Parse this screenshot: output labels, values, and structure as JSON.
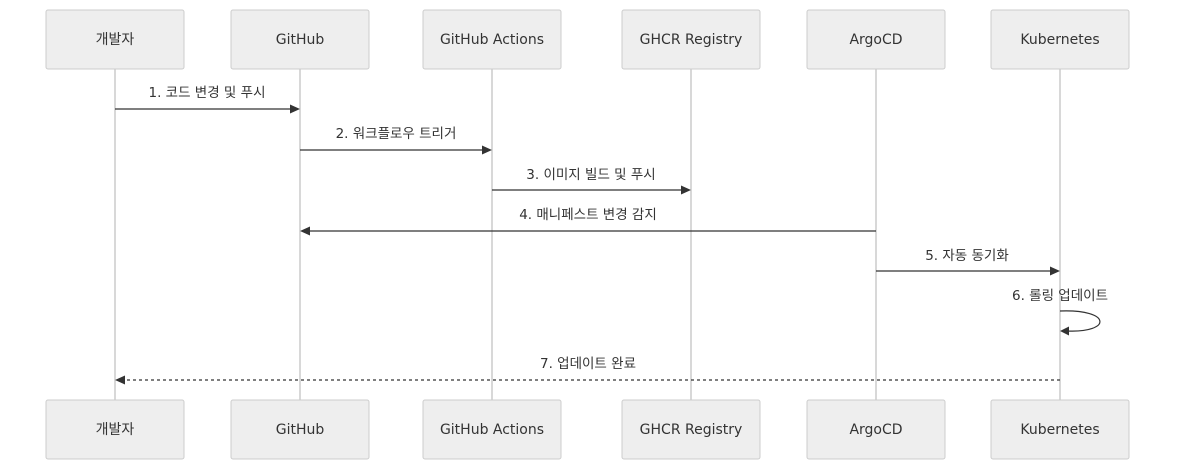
{
  "participants": [
    {
      "id": "dev",
      "label": "개발자"
    },
    {
      "id": "github",
      "label": "GitHub"
    },
    {
      "id": "actions",
      "label": "GitHub Actions"
    },
    {
      "id": "ghcr",
      "label": "GHCR Registry"
    },
    {
      "id": "argocd",
      "label": "ArgoCD"
    },
    {
      "id": "k8s",
      "label": "Kubernetes"
    }
  ],
  "messages": [
    {
      "from": "dev",
      "to": "github",
      "text": "1. 코드 변경 및 푸시",
      "style": "solid"
    },
    {
      "from": "github",
      "to": "actions",
      "text": "2. 워크플로우 트리거",
      "style": "solid"
    },
    {
      "from": "actions",
      "to": "ghcr",
      "text": "3. 이미지 빌드 및 푸시",
      "style": "solid"
    },
    {
      "from": "argocd",
      "to": "github",
      "text": "4. 매니페스트 변경 감지",
      "style": "solid"
    },
    {
      "from": "argocd",
      "to": "k8s",
      "text": "5. 자동 동기화",
      "style": "solid"
    },
    {
      "from": "k8s",
      "to": "k8s",
      "text": "6. 롤링 업데이트",
      "style": "solid"
    },
    {
      "from": "k8s",
      "to": "dev",
      "text": "7. 업데이트 완료",
      "style": "dashed"
    }
  ]
}
